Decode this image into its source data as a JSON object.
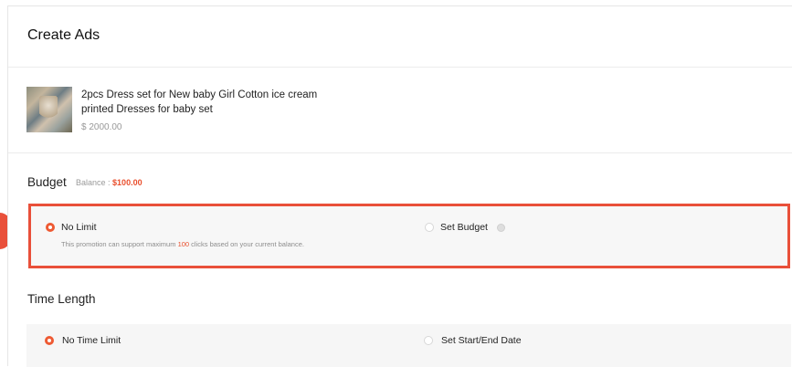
{
  "header": {
    "title": "Create Ads"
  },
  "product": {
    "name": "2pcs Dress set for New baby Girl Cotton ice cream printed Dresses for baby set",
    "price": "$ 2000.00"
  },
  "budget": {
    "title": "Budget",
    "balance_label": "Balance :",
    "balance_amount": "$100.00",
    "options": [
      {
        "label": "No Limit",
        "selected": true,
        "desc_prefix": "This promotion can support maximum",
        "desc_highlight": "100",
        "desc_suffix": "clicks based on your current balance."
      },
      {
        "label": "Set Budget",
        "selected": false
      }
    ]
  },
  "time_length": {
    "title": "Time Length",
    "options": [
      {
        "label": "No Time Limit",
        "selected": true
      },
      {
        "label": "Set Start/End Date",
        "selected": false
      }
    ]
  },
  "colors": {
    "accent": "#e9503a",
    "highlight_border": "#e9503a"
  }
}
